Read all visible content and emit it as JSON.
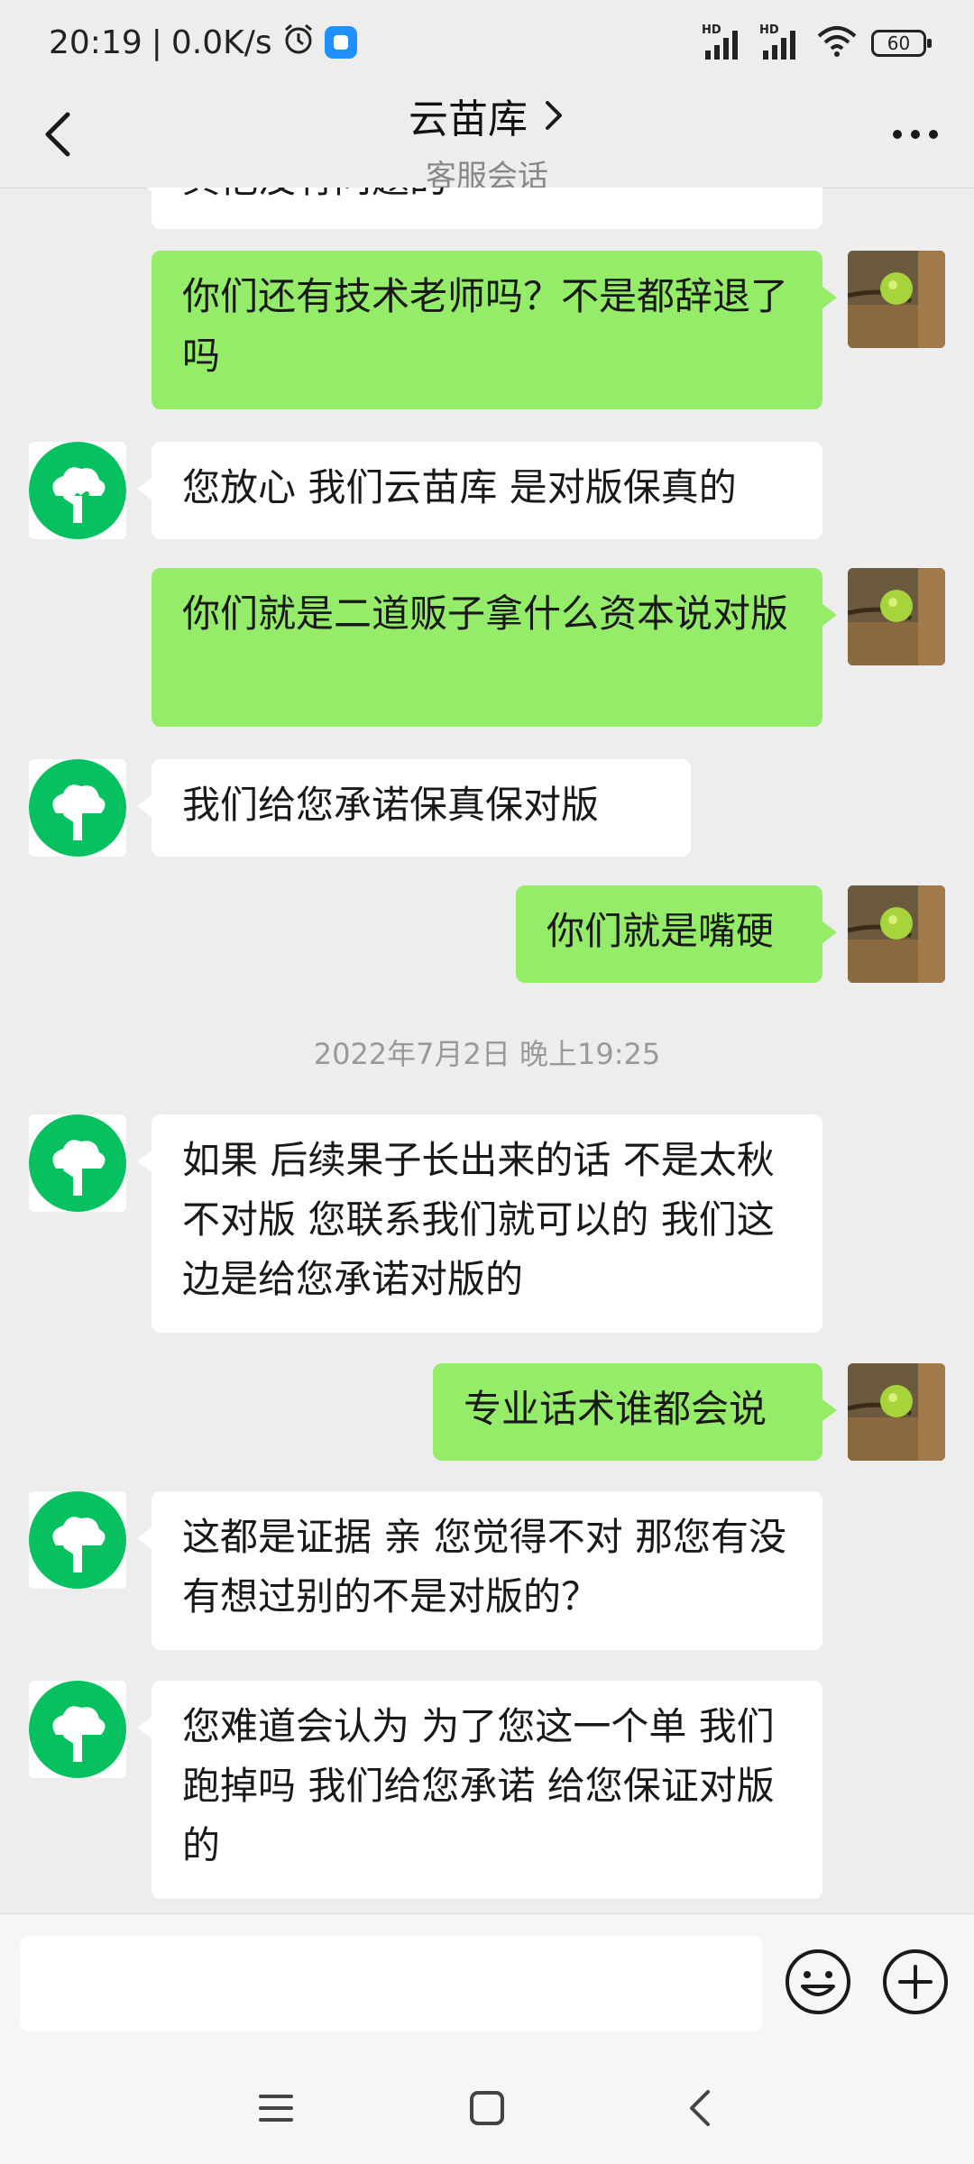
{
  "status_bar": {
    "time": "20:19",
    "separator": "|",
    "network_speed": "0.0K/s",
    "battery": "60",
    "signal_label_1": "HD",
    "signal_label_2": "HD",
    "icons": [
      "alarm-icon",
      "app-notification-icon",
      "hd-signal-icon",
      "hd-signal-icon",
      "wifi-icon",
      "battery-icon"
    ]
  },
  "header": {
    "title": "云苗库",
    "subtitle": "客服会话",
    "icons": [
      "back-arrow-icon",
      "chevron-right-icon",
      "more-dots-icon"
    ]
  },
  "messages": [
    {
      "sender": "bot",
      "text": "其他没有问题的"
    },
    {
      "sender": "user",
      "text": "你们还有技术老师吗？不是都辞退了吗"
    },
    {
      "sender": "bot",
      "text": "您放心 我们云苗库 是对版保真的"
    },
    {
      "sender": "user",
      "text": "你们就是二道贩子拿什么资本说对版"
    },
    {
      "sender": "bot",
      "text": "我们给您承诺保真保对版"
    },
    {
      "sender": "user",
      "text": "你们就是嘴硬"
    },
    {
      "sender": "system",
      "text": "2022年7月2日 晚上19:25"
    },
    {
      "sender": "bot",
      "text": "如果 后续果子长出来的话 不是太秋 不对版 您联系我们就可以的 我们这边是给您承诺对版的"
    },
    {
      "sender": "user",
      "text": "专业话术谁都会说"
    },
    {
      "sender": "bot",
      "text": "这都是证据 亲 您觉得不对 那您有没有想过别的不是对版的？"
    },
    {
      "sender": "bot",
      "text": "您难道会认为 为了您这一个单 我们跑掉吗 我们给您承诺 给您保证对版的"
    }
  ],
  "input": {
    "placeholder": ""
  },
  "colors": {
    "background": "#ededed",
    "user_bubble": "#95ec69",
    "bot_bubble": "#ffffff",
    "bot_avatar": "#07c160"
  }
}
